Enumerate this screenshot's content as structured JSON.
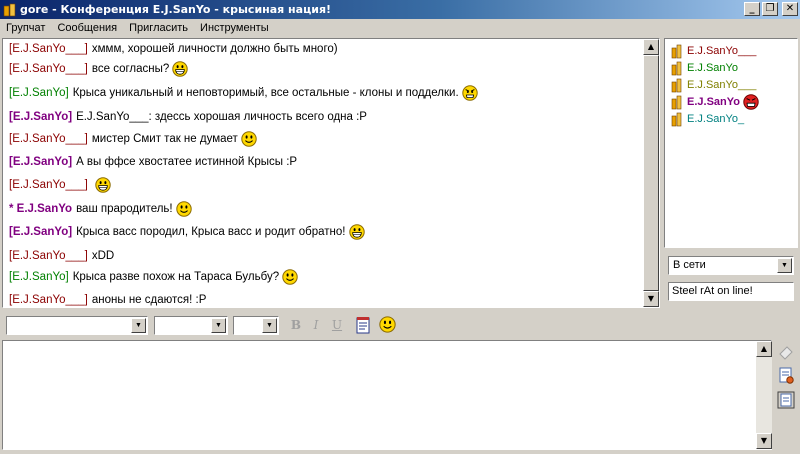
{
  "window": {
    "title": "gore - Конференция E.J.SanYo - крысиная нация!"
  },
  "menu": [
    "Групчат",
    "Сообщения",
    "Пригласить",
    "Инструменты"
  ],
  "messages": [
    {
      "nick": "[E.J.SanYo___]",
      "style": "red",
      "text": "хммм, хорошей личности должно быть много)",
      "smile": ""
    },
    {
      "nick": "[E.J.SanYo___]",
      "style": "red",
      "text": "все согласны?",
      "smile": "grin"
    },
    {
      "nick": "[E.J.SanYo]",
      "style": "green",
      "text": "Крыса уникальный и неповторимый, все остальные - клоны и подделки.",
      "smile": "angry"
    },
    {
      "nick": "[E.J.SanYo]",
      "style": "purple",
      "text": "E.J.SanYo___: здессь хорошая личность всего одна :P",
      "smile": ""
    },
    {
      "nick": "[E.J.SanYo___]",
      "style": "red",
      "text": "мистер Смит так не думает",
      "smile": "smile"
    },
    {
      "nick": "[E.J.SanYo]",
      "style": "purple",
      "text": "А вы ффсе хвостатее истинной Крысы :P",
      "smile": ""
    },
    {
      "nick": "[E.J.SanYo___]",
      "style": "red",
      "text": "",
      "smile": "grin"
    },
    {
      "nick": " * E.J.SanYo",
      "style": "action",
      "text": "ваш прародитель!",
      "smile": "smile"
    },
    {
      "nick": "[E.J.SanYo]",
      "style": "purple",
      "text": "Крыса васс породил, Крыса васс и родит обратно!",
      "smile": "grin"
    },
    {
      "nick": "[E.J.SanYo___]",
      "style": "red",
      "text": "xDD",
      "smile": ""
    },
    {
      "nick": "[E.J.SanYo]",
      "style": "green",
      "text": "Крыса разве похож на Тараса Бульбу?",
      "smile": "smile"
    },
    {
      "nick": "[E.J.SanYo___]",
      "style": "red",
      "text": "аноны не сдаются! :P",
      "smile": ""
    }
  ],
  "users": [
    {
      "name": "E.J.SanYo___",
      "color": "#8b0000",
      "selected": false
    },
    {
      "name": "E.J.SanYo",
      "color": "#008000",
      "selected": false
    },
    {
      "name": "E.J.SanYo___",
      "color": "#808000",
      "selected": false
    },
    {
      "name": "E.J.SanYo",
      "color": "#800080",
      "selected": true
    },
    {
      "name": "E.J.SanYo_",
      "color": "#008080",
      "selected": false
    }
  ],
  "status": {
    "value": "В сети",
    "message": "Steel rAt on line!"
  },
  "toolbar": {
    "font": "",
    "size": "",
    "color": "",
    "bold": "B",
    "italic": "I",
    "underline": "U"
  },
  "input": {
    "value": ""
  },
  "colors": {
    "titlebar": "#0a246a",
    "face": "#d4d0c8"
  }
}
